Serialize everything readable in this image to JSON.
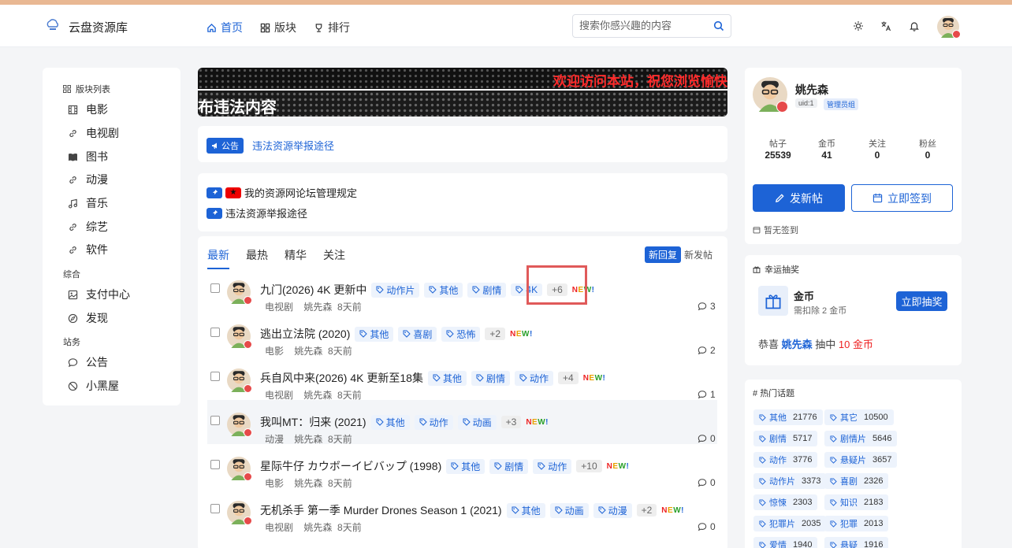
{
  "header": {
    "site_name": "云盘资源库",
    "nav": [
      {
        "label": "首页",
        "icon": "home-icon",
        "active": true
      },
      {
        "label": "版块",
        "icon": "grid-icon",
        "active": false
      },
      {
        "label": "排行",
        "icon": "trophy-icon",
        "active": false
      }
    ],
    "search_placeholder": "搜索你感兴趣的内容"
  },
  "sidebar": {
    "title": "版块列表",
    "items": [
      {
        "label": "电影",
        "icon": "film-icon"
      },
      {
        "label": "电视剧",
        "icon": "link-icon"
      },
      {
        "label": "图书",
        "icon": "book-icon"
      },
      {
        "label": "动漫",
        "icon": "link-icon"
      },
      {
        "label": "音乐",
        "icon": "music-icon"
      },
      {
        "label": "综艺",
        "icon": "link-icon"
      },
      {
        "label": "软件",
        "icon": "link-icon"
      }
    ],
    "group2": "综合",
    "items2": [
      {
        "label": "支付中心",
        "icon": "image-icon"
      },
      {
        "label": "发现",
        "icon": "compass-icon"
      }
    ],
    "group3": "站务",
    "items3": [
      {
        "label": "公告",
        "icon": "chat-icon"
      },
      {
        "label": "小黑屋",
        "icon": "ban-icon"
      }
    ]
  },
  "banner": {
    "marquee": "欢迎访问本站，祝您浏览愉快",
    "warning": "布违法内容"
  },
  "notice": {
    "badge": "公告",
    "link": "违法资源举报途径"
  },
  "pinned": [
    {
      "title": "我的资源网论坛管理规定"
    },
    {
      "title": "违法资源举报途径"
    }
  ],
  "tabs": [
    "最新",
    "最热",
    "精华",
    "关注"
  ],
  "sort": {
    "active": "新回复",
    "inactive": "新发帖"
  },
  "threads": [
    {
      "title": "九门(2026) 4K 更新中",
      "tags": [
        "动作片",
        "其他",
        "剧情",
        "4K"
      ],
      "more": "+6",
      "board": "电视剧",
      "author": "姚先森",
      "time": "8天前",
      "replies": "3"
    },
    {
      "title": "逃出立法院 (2020)",
      "tags": [
        "其他",
        "喜剧",
        "恐怖"
      ],
      "more": "+2",
      "board": "电影",
      "author": "姚先森",
      "time": "8天前",
      "replies": "2"
    },
    {
      "title": "兵自风中来(2026) 4K 更新至18集",
      "tags": [
        "其他",
        "剧情",
        "动作"
      ],
      "more": "+4",
      "board": "电视剧",
      "author": "姚先森",
      "time": "8天前",
      "replies": "1"
    },
    {
      "title": "我叫MT：归来 (2021)",
      "tags": [
        "其他",
        "动作",
        "动画"
      ],
      "more": "+3",
      "board": "动漫",
      "author": "姚先森",
      "time": "8天前",
      "replies": "0"
    },
    {
      "title": "星际牛仔 カウボーイビバップ (1998)",
      "tags": [
        "其他",
        "剧情",
        "动作"
      ],
      "more": "+10",
      "board": "电影",
      "author": "姚先森",
      "time": "8天前",
      "replies": "0"
    },
    {
      "title": "无机杀手 第一季 Murder Drones Season 1 (2021)",
      "tags": [
        "其他",
        "动画",
        "动漫"
      ],
      "more": "+2",
      "board": "电视剧",
      "author": "姚先森",
      "time": "8天前",
      "replies": "0"
    }
  ],
  "new_label": [
    "N",
    "E",
    "W",
    "!"
  ],
  "profile": {
    "name": "姚先森",
    "uid": "uid:1",
    "group": "管理员组",
    "stats": [
      {
        "label": "帖子",
        "value": "25539"
      },
      {
        "label": "金币",
        "value": "41"
      },
      {
        "label": "关注",
        "value": "0"
      },
      {
        "label": "粉丝",
        "value": "0"
      }
    ],
    "post_btn": "发新帖",
    "signin_btn": "立即签到",
    "signin_status": "暂无签到"
  },
  "lottery": {
    "title": "幸运抽奖",
    "prize": "金币",
    "cost": "需扣除 2 金币",
    "button": "立即抽奖",
    "congrats_prefix": "恭喜",
    "winner": "姚先森",
    "middle": "抽中",
    "amount": "10 金币"
  },
  "topics": {
    "title": "热门话题",
    "items": [
      {
        "label": "其他",
        "count": "21776"
      },
      {
        "label": "其它",
        "count": "10500"
      },
      {
        "label": "剧情",
        "count": "5717"
      },
      {
        "label": "剧情片",
        "count": "5646"
      },
      {
        "label": "动作",
        "count": "3776"
      },
      {
        "label": "悬疑片",
        "count": "3657"
      },
      {
        "label": "动作片",
        "count": "3373"
      },
      {
        "label": "喜剧",
        "count": "2326"
      },
      {
        "label": "惊悚",
        "count": "2303"
      },
      {
        "label": "知识",
        "count": "2183"
      },
      {
        "label": "犯罪片",
        "count": "2035"
      },
      {
        "label": "犯罪",
        "count": "2013"
      },
      {
        "label": "爱情",
        "count": "1940"
      },
      {
        "label": "悬疑",
        "count": "1916"
      }
    ]
  },
  "colors": {
    "accent": "#1d63d6",
    "highlight_box": "#e05a5a",
    "lottery_red": "#e22"
  }
}
